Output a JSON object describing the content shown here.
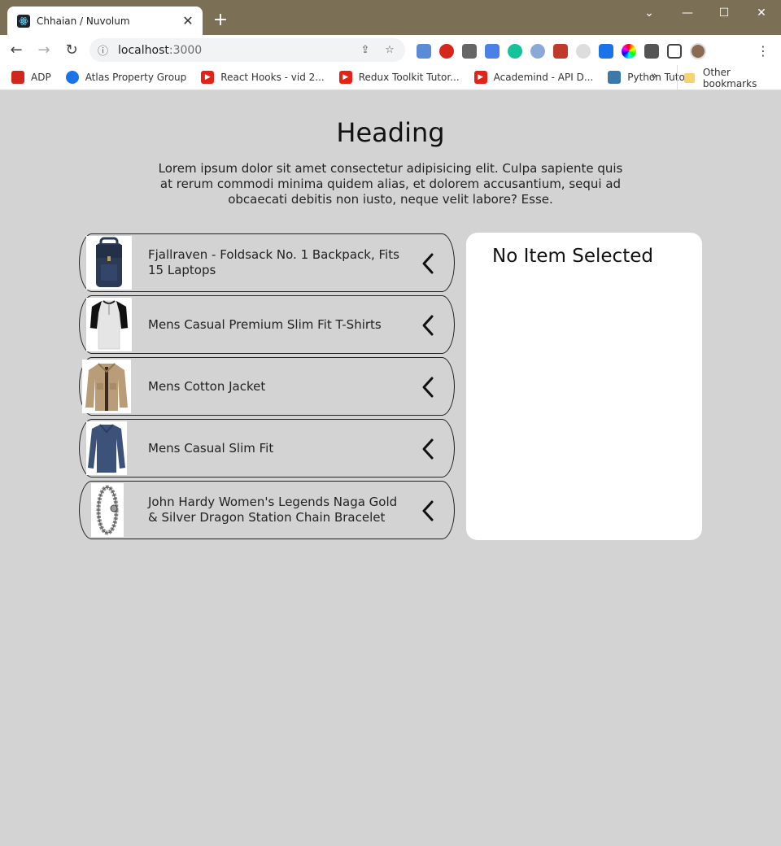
{
  "browser": {
    "tab_title": "Chhaian / Nuvolum",
    "url_host": "localhost",
    "url_port": ":3000",
    "bookmarks": [
      {
        "label": "ADP",
        "color": "#d0271d"
      },
      {
        "label": "Atlas Property Group",
        "color": "#1a73e8"
      },
      {
        "label": "React Hooks - vid 2...",
        "color": "#e62117"
      },
      {
        "label": "Redux Toolkit Tutor...",
        "color": "#e62117"
      },
      {
        "label": "Academind - API D...",
        "color": "#e62117"
      },
      {
        "label": "Python Tutor",
        "color": "#3c78aa"
      }
    ],
    "other_bookmarks": "Other bookmarks"
  },
  "page": {
    "heading": "Heading",
    "intro": "Lorem ipsum dolor sit amet consectetur adipisicing elit. Culpa sapiente quis at rerum commodi minima quidem alias, et dolorem accusantium, sequi ad obcaecati debitis non iusto, neque velit labore? Esse."
  },
  "products": [
    {
      "title": "Fjallraven - Foldsack No. 1 Backpack, Fits 15 Laptops",
      "icon": "backpack-icon",
      "color": "#2b3a55"
    },
    {
      "title": "Mens Casual Premium Slim Fit T-Shirts",
      "icon": "tshirt-icon",
      "color": "#e5e5e5"
    },
    {
      "title": "Mens Cotton Jacket",
      "icon": "jacket-icon",
      "color": "#b99d79"
    },
    {
      "title": "Mens Casual Slim Fit",
      "icon": "longsleeve-icon",
      "color": "#3c5278"
    },
    {
      "title": "John Hardy Women's Legends Naga Gold & Silver Dragon Station Chain Bracelet",
      "icon": "bracelet-icon",
      "color": "#9a9a9a"
    }
  ],
  "detail": {
    "title": "No Item Selected"
  }
}
